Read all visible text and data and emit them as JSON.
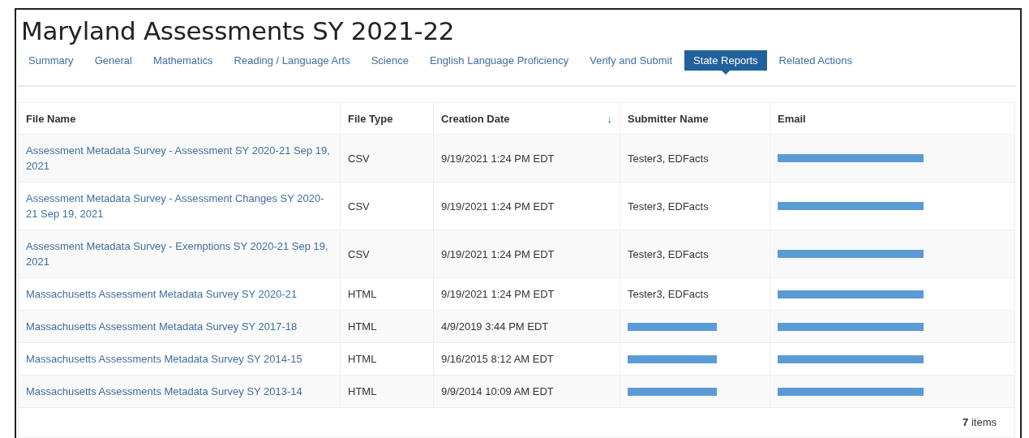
{
  "title": "Maryland Assessments SY 2021-22",
  "tabs": [
    {
      "label": "Summary",
      "selected": false
    },
    {
      "label": "General",
      "selected": false
    },
    {
      "label": "Mathematics",
      "selected": false
    },
    {
      "label": "Reading / Language Arts",
      "selected": false
    },
    {
      "label": "Science",
      "selected": false
    },
    {
      "label": "English Language Proficiency",
      "selected": false
    },
    {
      "label": "Verify and Submit",
      "selected": false
    },
    {
      "label": "State Reports",
      "selected": true
    },
    {
      "label": "Related Actions",
      "selected": false
    }
  ],
  "table": {
    "columns": [
      {
        "label": "File Name"
      },
      {
        "label": "File Type"
      },
      {
        "label": "Creation Date",
        "sort_indicator": "↓"
      },
      {
        "label": "Submitter Name"
      },
      {
        "label": "Email"
      }
    ],
    "rows": [
      {
        "file_name": "Assessment Metadata Survey - Assessment SY 2020-21 Sep 19, 2021",
        "file_type": "CSV",
        "creation_date": "9/19/2021 1:24 PM EDT",
        "submitter": {
          "kind": "text",
          "text": "Tester3, EDFacts"
        },
        "email": {
          "kind": "redacted"
        }
      },
      {
        "file_name": "Assessment Metadata Survey - Assessment Changes SY 2020-21 Sep 19, 2021",
        "file_type": "CSV",
        "creation_date": "9/19/2021 1:24 PM EDT",
        "submitter": {
          "kind": "text",
          "text": "Tester3, EDFacts"
        },
        "email": {
          "kind": "redacted"
        }
      },
      {
        "file_name": "Assessment Metadata Survey - Exemptions SY 2020-21 Sep 19, 2021",
        "file_type": "CSV",
        "creation_date": "9/19/2021 1:24 PM EDT",
        "submitter": {
          "kind": "text",
          "text": "Tester3, EDFacts"
        },
        "email": {
          "kind": "redacted"
        }
      },
      {
        "file_name": "Massachusetts Assessment Metadata Survey SY 2020-21",
        "file_type": "HTML",
        "creation_date": "9/19/2021 1:24 PM EDT",
        "submitter": {
          "kind": "text",
          "text": "Tester3, EDFacts"
        },
        "email": {
          "kind": "redacted"
        }
      },
      {
        "file_name": "Massachusetts Assessment Metadata Survey SY 2017-18",
        "file_type": "HTML",
        "creation_date": "4/9/2019 3:44 PM EDT",
        "submitter": {
          "kind": "redacted"
        },
        "email": {
          "kind": "redacted"
        }
      },
      {
        "file_name": "Massachusetts Assessments Metadata Survey SY 2014-15",
        "file_type": "HTML",
        "creation_date": "9/16/2015 8:12 AM EDT",
        "submitter": {
          "kind": "redacted"
        },
        "email": {
          "kind": "redacted"
        }
      },
      {
        "file_name": "Massachusetts Assessments Metadata Survey SY 2013-14",
        "file_type": "HTML",
        "creation_date": "9/9/2014 10:09 AM EDT",
        "submitter": {
          "kind": "redacted"
        },
        "email": {
          "kind": "redacted"
        }
      }
    ],
    "footer": "**7** items"
  }
}
